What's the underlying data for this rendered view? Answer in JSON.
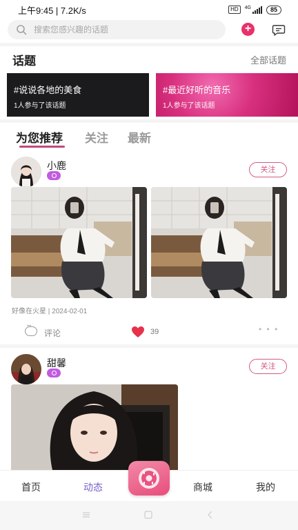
{
  "status_bar": {
    "time_speed": "上午9:45 | 7.2K/s",
    "hd": "HD",
    "network": "4G",
    "battery": "85"
  },
  "search": {
    "placeholder": "搜索您感兴趣的话题"
  },
  "topics": {
    "title": "话题",
    "all_label": "全部话题",
    "cards": [
      {
        "name": "#说说各地的美食",
        "participants": "1人参与了该话题"
      },
      {
        "name": "#最近好听的音乐",
        "participants": "1人参与了该话题"
      }
    ]
  },
  "tabs": [
    "为您推荐",
    "关注",
    "最新"
  ],
  "posts": [
    {
      "user": "小鹿",
      "follow_label": "关注",
      "meta": "好像在火星 | 2024-02-01",
      "comment_label": "评论",
      "likes": "39"
    },
    {
      "user": "甜馨",
      "follow_label": "关注"
    }
  ],
  "bottom_nav": [
    "首页",
    "动态",
    "商城",
    "我的"
  ],
  "colors": {
    "accent_pink": "#e8316a",
    "tab_underline": "#c2477b",
    "active_nav": "#7a62c9",
    "badge_purple": "#c15be0"
  },
  "icons": [
    "search-icon",
    "plus-icon",
    "message-icon",
    "comment-icon",
    "heart-icon",
    "more-icon",
    "donut-center-icon",
    "menu-icon",
    "home-icon",
    "back-icon"
  ]
}
